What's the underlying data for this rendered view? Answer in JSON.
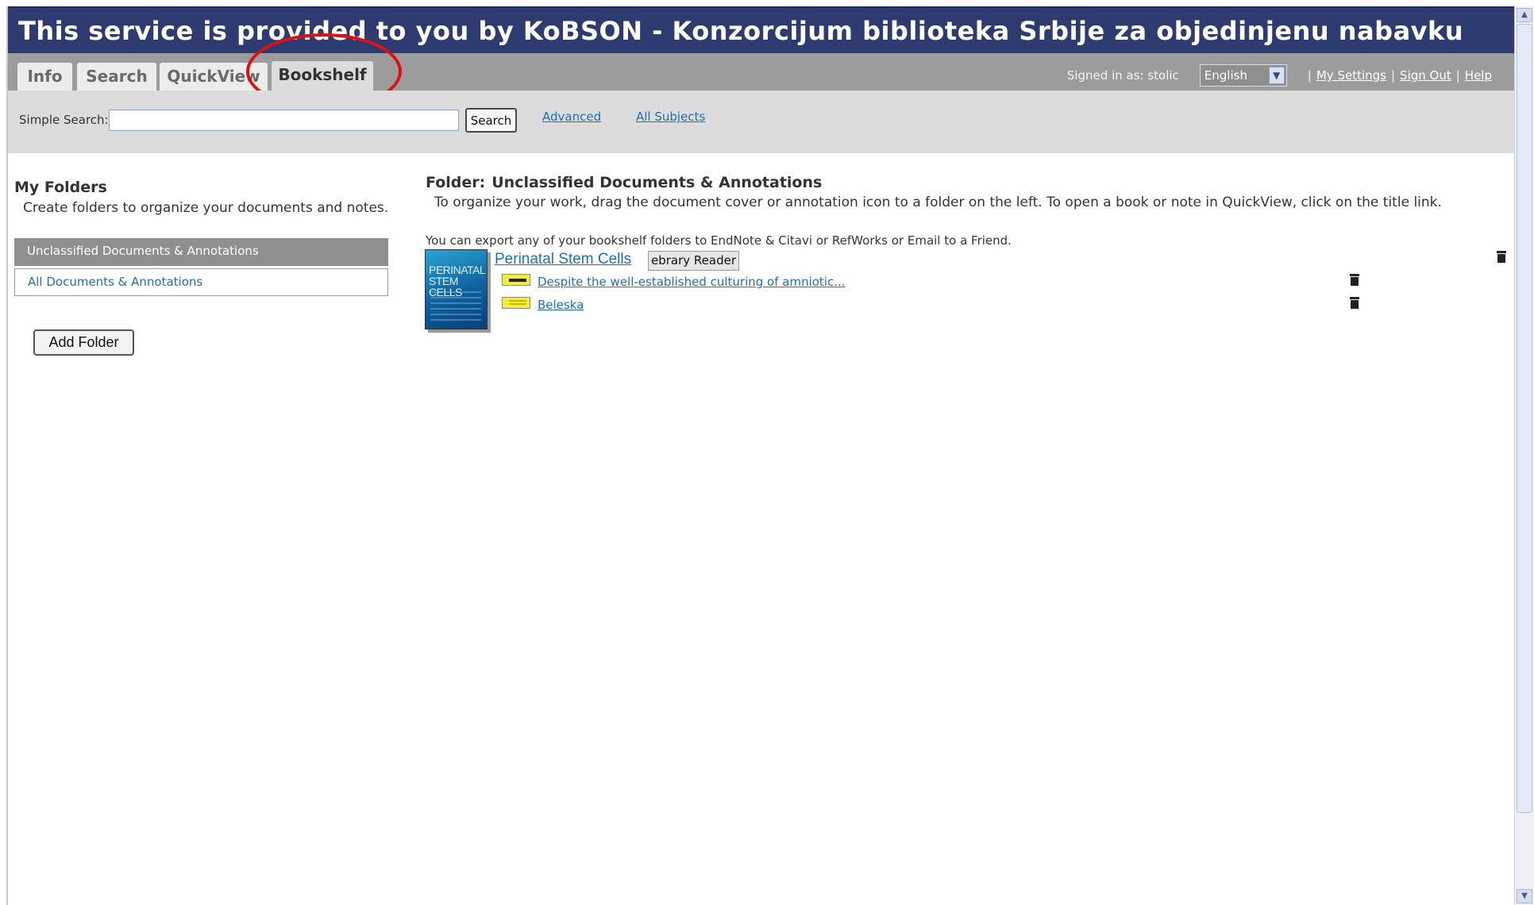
{
  "banner": {
    "text": "This service is provided to you by KoBSON - Konzorcijum biblioteka Srbije za objedinjenu nabavku"
  },
  "tabs": [
    {
      "label": "Info"
    },
    {
      "label": "Search"
    },
    {
      "label": "QuickView"
    },
    {
      "label": "Bookshelf",
      "active": true
    }
  ],
  "user": {
    "signed_in": "Signed in as: stolic",
    "language": "English",
    "my_settings": "My Settings",
    "sign_out": "Sign Out",
    "help": "Help",
    "separator": "|"
  },
  "search": {
    "label": "Simple Search:",
    "value": "",
    "button": "Search",
    "advanced": "Advanced",
    "all_subjects": "All Subjects"
  },
  "folders": {
    "title": "My Folders",
    "description": "Create folders to organize your documents and notes.",
    "items": [
      {
        "label": "Unclassified Documents & Annotations",
        "selected": true
      },
      {
        "label": "All Documents & Annotations",
        "selected": false
      }
    ],
    "add_button": "Add Folder"
  },
  "main": {
    "folder_label": "Folder:",
    "folder_name": "Unclassified Documents & Annotations",
    "description": "To organize your work, drag the document cover or annotation icon to a folder on the left. To open a book or note in QuickView, click on the title link.",
    "export_note": "You can export any of your bookshelf folders to EndNote & Citavi or RefWorks or Email to a Friend.",
    "book": {
      "cover_text": "Perinatal Stem Cells",
      "title": "Perinatal Stem Cells",
      "reader_button": "ebrary Reader",
      "annotations": [
        {
          "type": "highlight",
          "text": "Despite the well-established culturing of amniotic..."
        },
        {
          "type": "note",
          "text": "Beleska"
        }
      ]
    }
  },
  "colors": {
    "banner_bg": "#2d3b70",
    "tabbar_bg": "#9c9c9c",
    "link": "#1f6fb4",
    "highlight_circle": "#e01010",
    "annotation_yellow": "#f2ec3a"
  },
  "icons": [
    "trash-icon",
    "highlight-annotation-icon",
    "note-annotation-icon",
    "chevron-down-icon"
  ]
}
